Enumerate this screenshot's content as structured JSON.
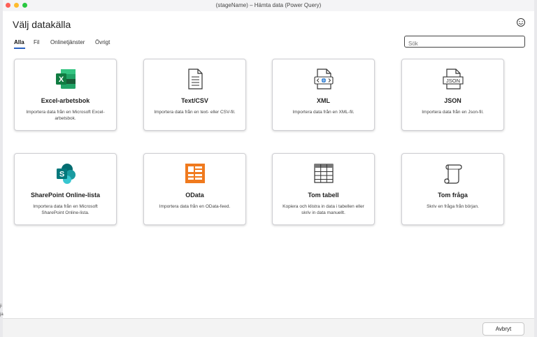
{
  "window": {
    "title": "(stageName) – Hämta data (Power Query)"
  },
  "header": {
    "heading": "Välj datakälla"
  },
  "tabs": [
    {
      "label": "Alla",
      "active": true
    },
    {
      "label": "Fil"
    },
    {
      "label": "Onlinetjänster"
    },
    {
      "label": "Övrigt"
    }
  ],
  "search": {
    "placeholder": "Sök"
  },
  "cards": [
    {
      "title": "Excel-arbetsbok",
      "description": "Importera data från en Microsoft Excel-arbetsbok.",
      "icon": "excel-icon"
    },
    {
      "title": "Text/CSV",
      "description": "Importera data från en text- eller CSV-fil.",
      "icon": "text-file-icon"
    },
    {
      "title": "XML",
      "description": "Importera data från en XML-fil.",
      "icon": "xml-file-icon"
    },
    {
      "title": "JSON",
      "description": "Importera data från en Json-fil.",
      "icon": "json-file-icon"
    },
    {
      "title": "SharePoint Online-lista",
      "description": "Importera data från en Microsoft SharePoint Online-lista.",
      "icon": "sharepoint-icon"
    },
    {
      "title": "OData",
      "description": "Importera data från en OData-feed.",
      "icon": "odata-icon"
    },
    {
      "title": "Tom tabell",
      "description": "Kopiera och klistra in data i tabellen eller skriv in data manuellt.",
      "icon": "table-icon"
    },
    {
      "title": "Tom fråga",
      "description": "Skriv en fråga från början.",
      "icon": "scroll-icon"
    }
  ],
  "footer": {
    "cancel_label": "Avbryt"
  },
  "background": {
    "edge_text_1": "ji",
    "edge_text_2": "ja"
  },
  "colors": {
    "accent": "#2b62c2",
    "excel": "#107c41",
    "sharepoint": "#036c70",
    "odata": "#f07a1e"
  }
}
